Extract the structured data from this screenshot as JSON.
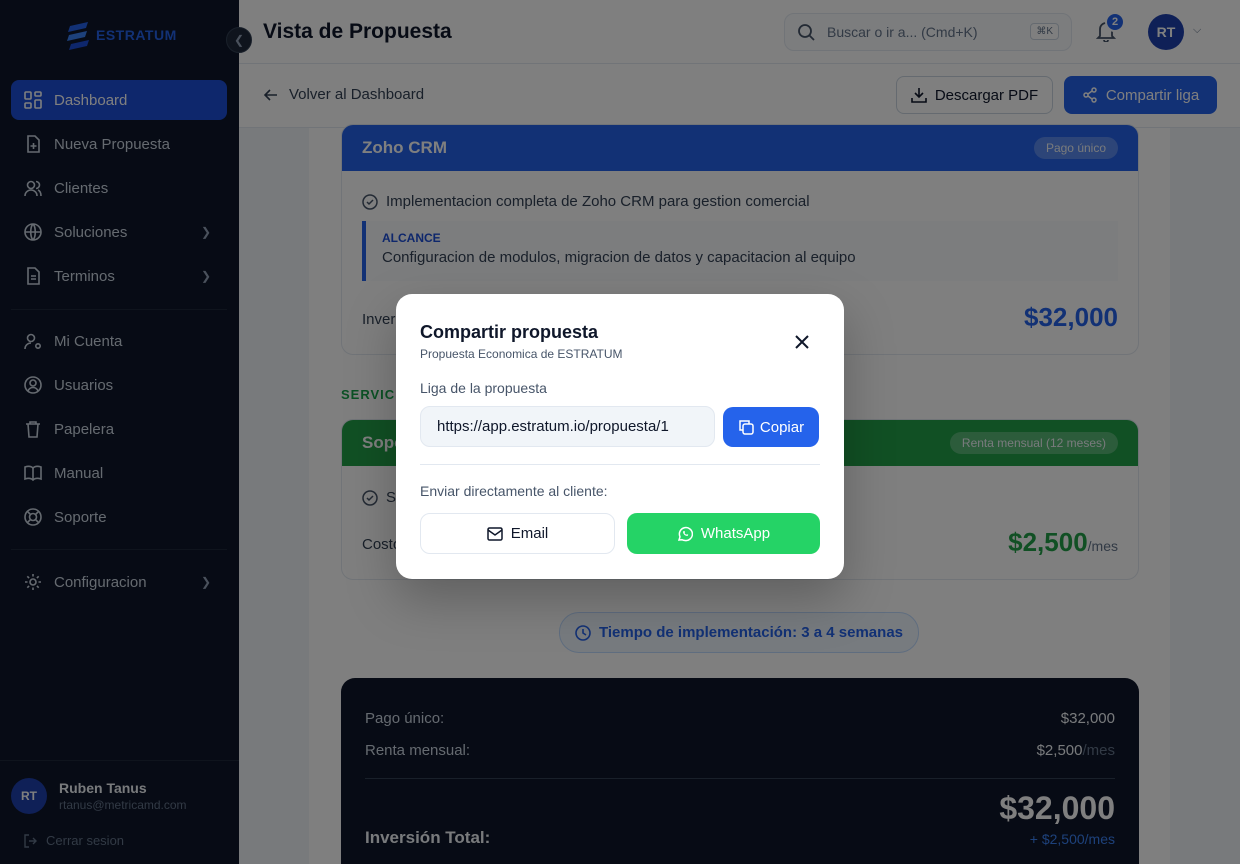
{
  "app": {
    "brand": "ESTRATUM"
  },
  "sidebar": {
    "items": [
      {
        "label": "Dashboard",
        "icon": "dashboard-icon",
        "active": true
      },
      {
        "label": "Nueva Propuesta",
        "icon": "file-plus-icon"
      },
      {
        "label": "Clientes",
        "icon": "users-icon"
      },
      {
        "label": "Soluciones",
        "icon": "globe-icon",
        "has_submenu": true
      },
      {
        "label": "Terminos",
        "icon": "file-text-icon",
        "has_submenu": true
      },
      {
        "label": "Mi Cuenta",
        "icon": "user-cog-icon"
      },
      {
        "label": "Usuarios",
        "icon": "user-circle-icon"
      },
      {
        "label": "Papelera",
        "icon": "trash-icon"
      },
      {
        "label": "Manual",
        "icon": "book-icon"
      },
      {
        "label": "Soporte",
        "icon": "life-buoy-icon"
      },
      {
        "label": "Configuracion",
        "icon": "gear-icon",
        "has_submenu": true
      }
    ],
    "user": {
      "initials": "RT",
      "name": "Ruben Tanus",
      "email": "rtanus@metricamd.com"
    },
    "logout_label": "Cerrar sesion"
  },
  "header": {
    "title": "Vista de Propuesta",
    "search_placeholder": "Buscar o ir a... (Cmd+K)",
    "search_shortcut": "⌘K",
    "notifications_count": "2",
    "user_initials": "RT"
  },
  "toolbar": {
    "back_label": "Volver al Dashboard",
    "pdf_label": "Descargar PDF",
    "share_label": "Compartir liga"
  },
  "proposal": {
    "card1": {
      "title": "Zoho CRM",
      "badge": "Pago único",
      "feature": "Implementacion completa de Zoho CRM para gestion comercial",
      "scope_title": "ALCANCE",
      "scope_text": "Configuracion de modulos, migracion de datos y capacitacion al equipo",
      "price_label": "Inver",
      "price": "$32,000"
    },
    "section_label": "SERVICI",
    "card2": {
      "title": "Sopo",
      "badge": "Renta mensual (12 meses)",
      "feature": "Se",
      "price_label": "Costo",
      "price": "$2,500",
      "per": "/mes"
    },
    "timeline": "Tiempo de implementación: 3 a 4 semanas",
    "summary": {
      "one_time_label": "Pago único:",
      "one_time_value": "$32,000",
      "monthly_label": "Renta mensual:",
      "monthly_value": "$2,500",
      "monthly_per": "/mes",
      "total_label": "Inversión Total:",
      "total_value": "$32,000",
      "total_sub": "+ $2,500/mes"
    }
  },
  "modal": {
    "title": "Compartir propuesta",
    "subtitle": "Propuesta Economica de ESTRATUM",
    "link_label": "Liga de la propuesta",
    "link_value": "https://app.estratum.io/propuesta/1",
    "copy_label": "Copiar",
    "send_label": "Enviar directamente al cliente:",
    "email_label": "Email",
    "whatsapp_label": "WhatsApp"
  },
  "colors": {
    "primary": "#2563eb",
    "sidebar_bg": "#0f172a",
    "green": "#22a049",
    "whatsapp": "#25d366"
  }
}
